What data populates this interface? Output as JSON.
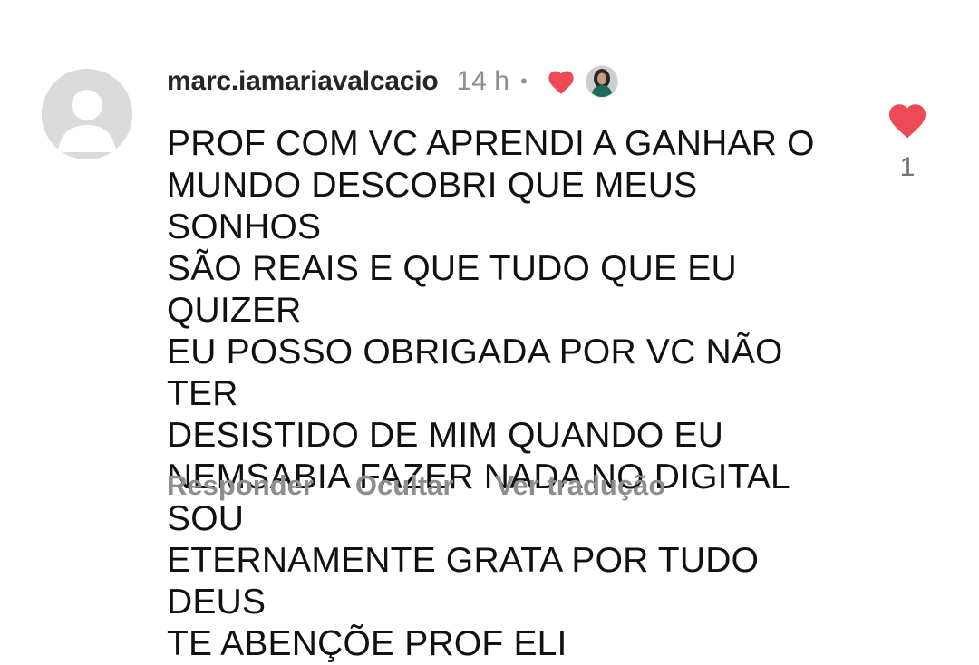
{
  "comment": {
    "username": "marc.iamariavalcacio",
    "time": "14 h",
    "separator": "•",
    "text": "PROF COM VC APRENDI A GANHAR O\nMUNDO DESCOBRI QUE MEUS SONHOS\nSÃO REAIS E QUE TUDO QUE EU QUIZER\nEU POSSO OBRIGADA POR VC NÃO TER\nDESISTIDO DE MIM QUANDO EU\nNEMSABIA FAZER NADA NO DIGITAL SOU\nETERNAMENTE GRATA POR TUDO DEUS\nTE ABENÇÕE PROF ELI",
    "like_count": "1",
    "creator_liked": true
  },
  "actions": {
    "reply": "Responder",
    "hide": "Ocultar",
    "translate": "Ver tradução"
  },
  "colors": {
    "heart": "#ED4956",
    "secondary_text": "#8e8e8e",
    "avatar_placeholder": "#d8d8d8"
  },
  "icons": {
    "avatar": "default-avatar-icon",
    "creator_heart": "heart-filled-icon",
    "like_button": "heart-filled-icon"
  }
}
